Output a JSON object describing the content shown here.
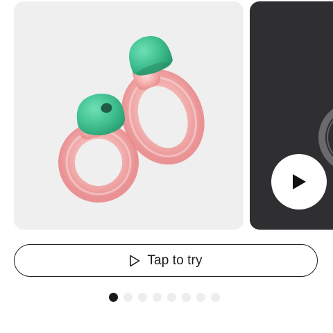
{
  "carousel": {
    "slides": [
      {
        "kind": "product-image",
        "icon": "earplugs-image"
      },
      {
        "kind": "video",
        "icon": "play-icon"
      }
    ],
    "active_index": 0,
    "dot_count": 8
  },
  "try_button": {
    "label": "Tap to try",
    "icon": "play-outline-icon"
  },
  "colors": {
    "product_bg": "#efefef",
    "video_bg": "#2f2f31",
    "tip_green": "#4cc79b",
    "ring_pink": "#f2a6a6",
    "dot_active": "#1a1a1a",
    "dot_inactive": "#ededed"
  }
}
